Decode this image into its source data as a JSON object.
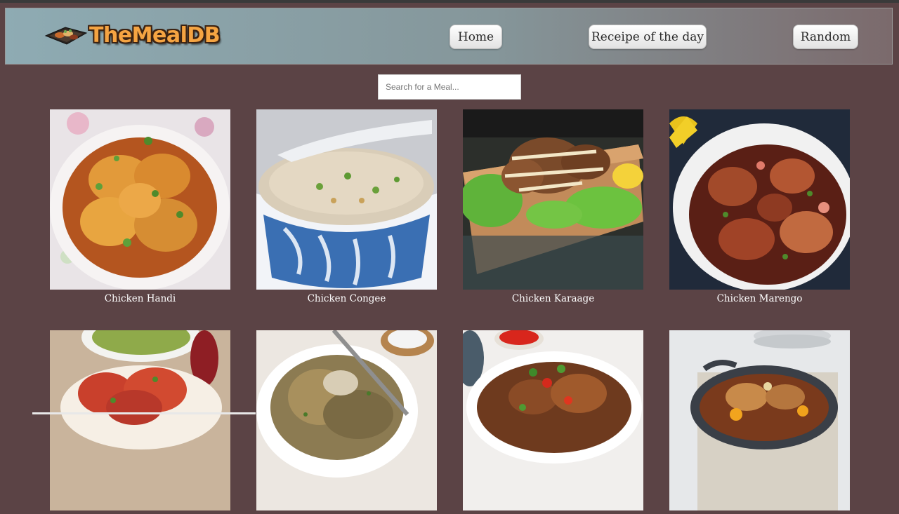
{
  "brand": {
    "name": "TheMealDB"
  },
  "nav": [
    {
      "label": "Home"
    },
    {
      "label": "Receipe of the day"
    },
    {
      "label": "Random"
    }
  ],
  "search": {
    "placeholder": "Search for a Meal...",
    "value": ""
  },
  "meals": [
    {
      "name": "Chicken Handi"
    },
    {
      "name": "Chicken Congee"
    },
    {
      "name": "Chicken Karaage"
    },
    {
      "name": "Chicken Marengo"
    },
    {
      "name": ""
    },
    {
      "name": ""
    },
    {
      "name": ""
    },
    {
      "name": ""
    }
  ],
  "colors": {
    "page_background": "#5b4345",
    "header_gradient_start": "#8eabb3",
    "header_gradient_end": "#7b6a6c",
    "logo_text": "#f5a442",
    "meal_title_text": "#ffffff"
  }
}
